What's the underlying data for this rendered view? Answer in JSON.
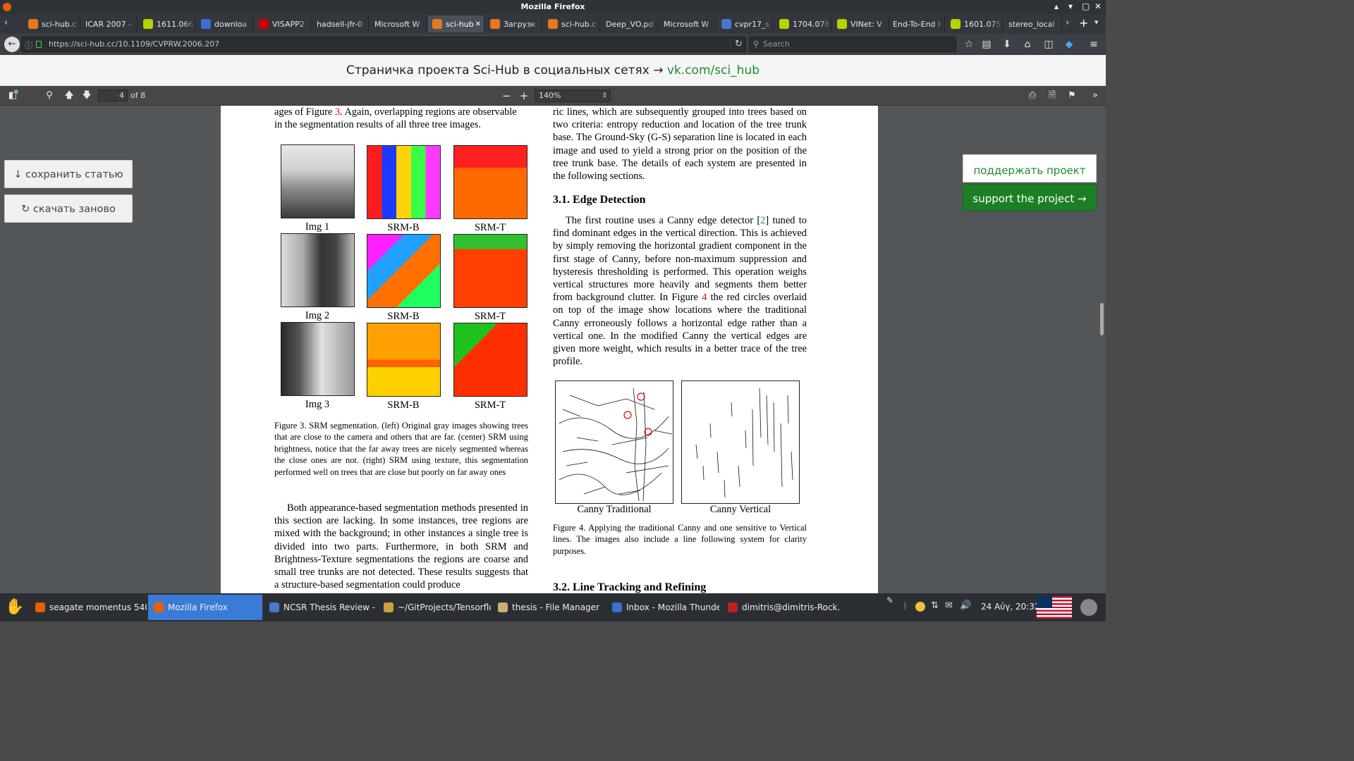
{
  "window": {
    "title": "Mozilla Firefox"
  },
  "tabs": [
    {
      "label": "sci-hub.c",
      "icon": "scihub-icon",
      "active": false
    },
    {
      "label": "ICAR 2007 -",
      "icon": "",
      "active": false
    },
    {
      "label": "1611.066",
      "icon": "arxiv-icon",
      "active": false
    },
    {
      "label": "downloa",
      "icon": "download-page-icon",
      "active": false
    },
    {
      "label": "VISAPP2",
      "icon": "doc-icon",
      "active": false
    },
    {
      "label": "hadsell-jfr-0",
      "icon": "",
      "active": false
    },
    {
      "label": "Microsoft W",
      "icon": "",
      "active": false
    },
    {
      "label": "sci-hub",
      "icon": "scihub-icon",
      "active": true
    },
    {
      "label": "Загрузк",
      "icon": "scihub-icon",
      "active": false
    },
    {
      "label": "sci-hub.c",
      "icon": "scihub-icon",
      "active": false
    },
    {
      "label": "Deep_VO.pd",
      "icon": "",
      "active": false
    },
    {
      "label": "Microsoft W",
      "icon": "",
      "active": false
    },
    {
      "label": "cvpr17_s",
      "icon": "bookmark-icon",
      "active": false
    },
    {
      "label": "1704.078",
      "icon": "arxiv-icon",
      "active": false
    },
    {
      "label": "VINet: V",
      "icon": "arxiv-icon",
      "active": false
    },
    {
      "label": "End-To-End I",
      "icon": "",
      "active": false
    },
    {
      "label": "1601.075",
      "icon": "arxiv-icon",
      "active": false
    },
    {
      "label": "stereo_local",
      "icon": "",
      "active": false
    }
  ],
  "nav": {
    "url": "https://sci-hub.cc/10.1109/CVPRW.2006.207",
    "search_placeholder": "Search"
  },
  "banner": {
    "text": "Страничка проекта Sci-Hub в социальных сетях → ",
    "link": "vk.com/sci_hub"
  },
  "pdf_toolbar": {
    "page_number": "4",
    "page_count": "of 8",
    "zoom": "140%"
  },
  "side_buttons": {
    "save": "↓ сохранить статью",
    "redownload": "↻ скачать заново",
    "support_ru": "поддержать проект",
    "support_en": "support the project →"
  },
  "paper": {
    "left_top_1a": "ages of Figure ",
    "left_top_1ref": "3",
    "left_top_1b": ". Again, overlapping regions are observable",
    "left_top_2": "in the segmentation results of all three tree images.",
    "fig3_labels": {
      "img1": "Img 1",
      "img2": "Img 2",
      "img3": "Img 3",
      "srmb": "SRM-B",
      "srmt": "SRM-T"
    },
    "fig3_caption": "Figure 3. SRM segmentation. (left) Original gray images showing trees that are close to the camera and others that are far. (center) SRM using brightness, notice that the far away trees are nicely segmented whereas the close ones are not. (right) SRM using texture, this segmentation performed well on trees that are close but poorly on far away ones",
    "left_bottom": "Both appearance-based segmentation methods presented in this section are lacking. In some instances, tree regions are mixed with the background; in other instances a single tree is divided into two parts. Furthermore, in both SRM and Brightness-Texture segmentations the regions are coarse and small tree trunks are not detected. These results suggests that a structure-based segmentation could produce",
    "right_top": "ric lines, which are subsequently grouped into trees based on two criteria: entropy reduction and location of the tree trunk base. The Ground-Sky (G-S) separation line is located in each image and used to yield a strong prior on the position of the tree trunk base. The details of each system are presented in the following sections.",
    "section_31": "3.1. Edge Detection",
    "edge_a": "The first routine uses a Canny edge detector [",
    "edge_ref": "2",
    "edge_b": "] tuned to find dominant edges in the vertical direction. This is achieved by simply removing the horizontal gradient component in the first stage of Canny, before non-maximum suppression and hysteresis thresholding is performed. This operation weighs vertical structures more heavily and segments them better from background clutter. In Figure ",
    "edge_fig": "4",
    "edge_c": " the red circles overlaid on top of the image show locations where the traditional Canny erroneously follows a horizontal edge rather than a vertical one. In the modified Canny the vertical edges are given more weight, which results in a better trace of the tree profile.",
    "fig4_left": "Canny Traditional",
    "fig4_right": "Canny Vertical",
    "fig4_caption": "Figure 4. Applying the traditional Canny and one sensitive to Vertical lines. The images also include a line following system for clarity purposes.",
    "section_32": "3.2. Line Tracking and Refining"
  },
  "taskbar": {
    "items": [
      {
        "label": "seagate momentus 540...",
        "active": false
      },
      {
        "label": "Mozilla Firefox",
        "active": true
      },
      {
        "label": "NCSR Thesis Review - ...",
        "active": false
      },
      {
        "label": "~/GitProjects/Tensorflo...",
        "active": false
      },
      {
        "label": "thesis - File Manager",
        "active": false
      },
      {
        "label": "Inbox - Mozilla Thunder...",
        "active": false
      },
      {
        "label": "dimitris@dimitris-Rock...",
        "active": false
      }
    ],
    "clock": "24 Αύγ, 20:32"
  },
  "colors": {
    "accent_green": "#1f8a2e",
    "support_bg": "#1c7f24",
    "ref_red": "#e00000",
    "taskbar_active": "#3a7bd5"
  }
}
